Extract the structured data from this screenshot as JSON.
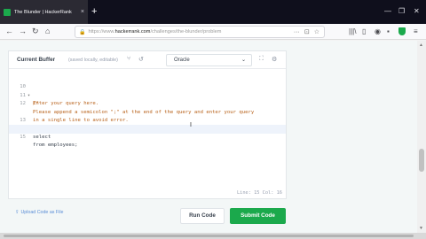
{
  "browser": {
    "tab_title": "The Blunder | HackerRank",
    "tab_close": "×",
    "new_tab": "+",
    "window_controls": [
      "—",
      "❐",
      "✕"
    ],
    "nav": {
      "back": "←",
      "forward": "→",
      "reload": "↻",
      "home": "⌂"
    },
    "url_prefix": "https://www.",
    "url_domain": "hackerrank.com",
    "url_path": "/challenges/the-blunder/problem",
    "url_more": "···",
    "url_pocket": "⊡",
    "url_bookmark": "☆",
    "toolbar": {
      "library": "|||\\",
      "sidebar": "▯",
      "account": "◉",
      "menu": "≡"
    }
  },
  "editor": {
    "buffer_title": "Current Buffer",
    "buffer_subtitle": "(saved locally, editable)",
    "language": "Oracle",
    "lines": [
      {
        "n": "10",
        "fold": "▾",
        "text": "/*"
      },
      {
        "n": "11",
        "fold": "",
        "text": "Enter your query here."
      },
      {
        "n": "12",
        "fold": "",
        "text": "Please append a semicolon \";\" at the end of the query and enter your query"
      },
      {
        "n": "",
        "fold": "",
        "text": "in a single line to avoid error."
      },
      {
        "n": "13",
        "fold": "",
        "text": "*/"
      },
      {
        "n": "14",
        "fold": "",
        "text": "select"
      },
      {
        "n": "15",
        "fold": "",
        "text": "from employees;"
      }
    ],
    "status": "Line: 15 Col: 16"
  },
  "actions": {
    "upload_label": "Upload Code as File",
    "run_label": "Run Code",
    "submit_label": "Submit Code"
  },
  "colors": {
    "accent_green": "#1ba94c",
    "comment_orange": "#b8621b"
  }
}
